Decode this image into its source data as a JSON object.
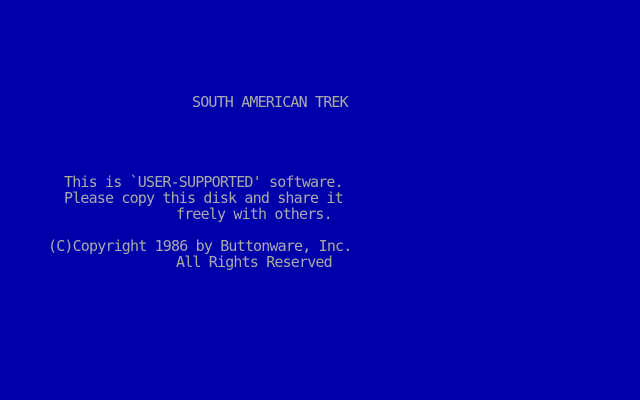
{
  "colors": {
    "background": "#0000aa",
    "text": "#aaaaaa"
  },
  "title": "SOUTH AMERICAN TREK",
  "notice": {
    "line1": "This is `USER-SUPPORTED' software.",
    "line2": "Please copy this disk and share it",
    "line3": "freely with others."
  },
  "copyright": {
    "line1": "(C)Copyright 1986 by Buttonware, Inc.",
    "line2": "All Rights Reserved"
  }
}
